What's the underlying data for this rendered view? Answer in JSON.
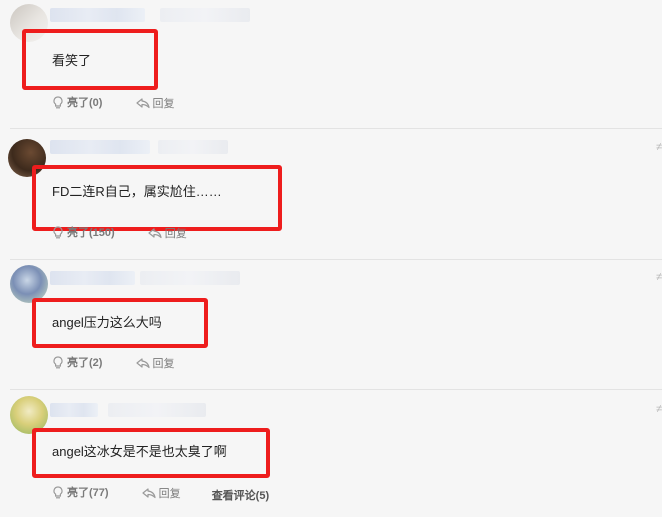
{
  "comments": [
    {
      "text": "看笑了",
      "like_label": "亮了(0)",
      "reply_label": "回复"
    },
    {
      "text": "FD二连R自己，属实尬住……",
      "like_label": "亮了(150)",
      "reply_label": "回复"
    },
    {
      "text": "angel压力这么大吗",
      "like_label": "亮了(2)",
      "reply_label": "回复"
    },
    {
      "text": "angel这冰女是不是也太臭了啊",
      "like_label": "亮了(77)",
      "reply_label": "回复",
      "more_label": "查看评论(5)"
    }
  ],
  "corner_glyph": "≠",
  "colors": {
    "highlight": "#ee1d1d",
    "background": "#f6f6f6",
    "action_text": "#7a7a7a"
  },
  "icons": {
    "like": "lightbulb-icon",
    "reply": "reply-arrow-icon"
  }
}
